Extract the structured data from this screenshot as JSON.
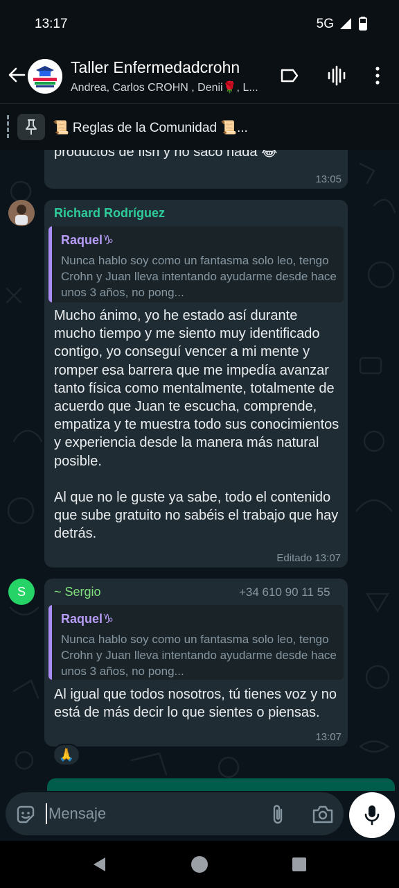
{
  "status_bar": {
    "time": "13:17",
    "network": "5G"
  },
  "header": {
    "title": "Taller Enfermedadcrohn",
    "subtitle": "Andrea, Carlos CROHN , Denii🌹, L...",
    "avatar_lines": [
      "Academia",
      "Enfermedad",
      "Crohn"
    ]
  },
  "pinned": {
    "text": "📜 Reglas de la Comunidad 📜..."
  },
  "messages": [
    {
      "text": "productos de fish y no saco nada 😂",
      "time": "13:05"
    },
    {
      "sender": "Richard Rodríguez",
      "sender_color": "#2ecc9a",
      "quote": {
        "name": "Raquel♑",
        "text": "Nunca hablo soy como un fantasma solo leo, tengo Crohn y Juan lleva intentando ayudarme desde hace unos 3 años, no pong..."
      },
      "text": "Mucho ánimo, yo he estado así durante mucho tiempo y me siento muy identificado contigo, yo conseguí vencer a mi mente y romper esa barrera que me impedía avanzar tanto física como mentalmente, totalmente de acuerdo que Juan te escucha, comprende, empatiza y te muestra todo sus conocimientos y experiencia desde la manera más natural posible.\n\nAl que no le guste ya sabe, todo el contenido que sube gratuito no sabéis el trabajo que hay detrás.",
      "time": "Editado 13:07"
    },
    {
      "sender": "~ Sergio",
      "sender_color": "#7ee07a",
      "phone": "+34 610 90 11 55",
      "avatar_letter": "S",
      "quote": {
        "name": "Raquel♑",
        "text": "Nunca hablo soy como un fantasma solo leo, tengo Crohn y Juan lleva intentando ayudarme desde hace unos 3 años, no pong..."
      },
      "text": "Al igual que todos nosotros, tú tienes voz y no está de más decir lo que sientes o piensas.",
      "time": "13:07",
      "reaction": "🙏"
    }
  ],
  "input": {
    "placeholder": "Mensaje"
  },
  "colors": {
    "accent": "#25d366",
    "bubble": "#202c33",
    "background": "#0b141a"
  }
}
